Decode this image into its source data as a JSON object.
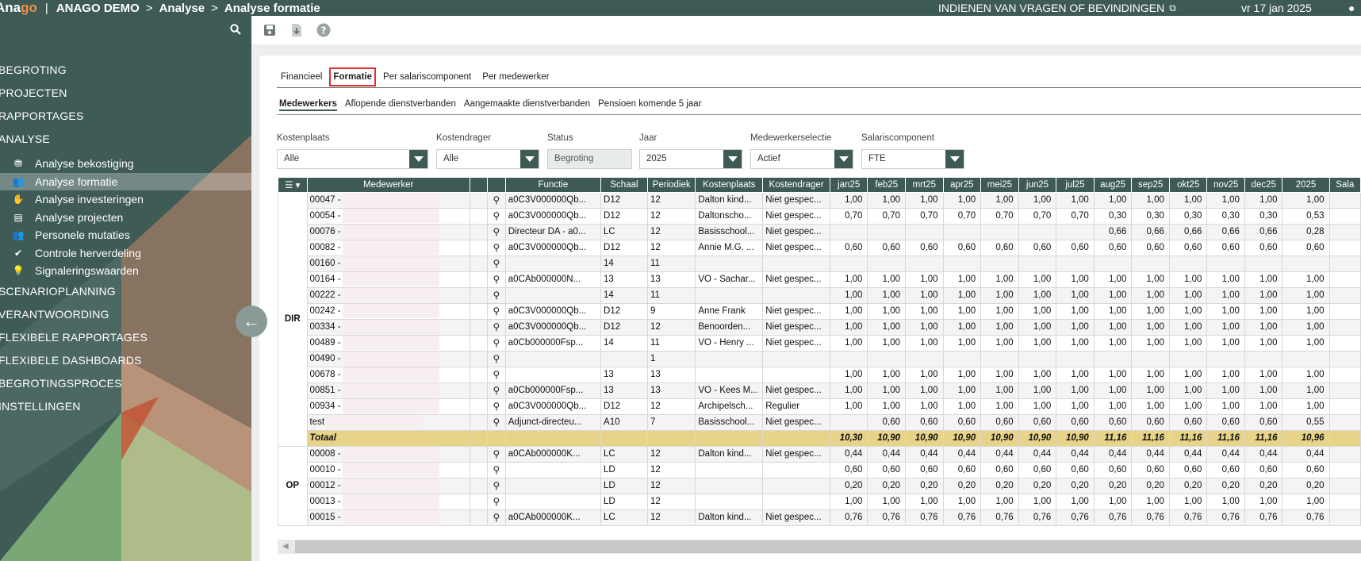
{
  "header": {
    "logo_a": "Ana",
    "logo_b": "go",
    "title": "ANAGO DEMO",
    "crumb1": "Analyse",
    "crumb2": "Analyse formatie",
    "report_link": "INDIENEN VAN VRAGEN OF BEVINDINGEN",
    "date": "vr 17 jan 2025"
  },
  "menu": {
    "top": [
      "BEGROTING",
      "PROJECTEN",
      "RAPPORTAGES",
      "ANALYSE"
    ],
    "sub": [
      {
        "label": "Analyse bekostiging",
        "icon": "coins-icon",
        "glyph": "⛃"
      },
      {
        "label": "Analyse formatie",
        "icon": "users-icon",
        "glyph": "👥"
      },
      {
        "label": "Analyse investeringen",
        "icon": "hand-coin-icon",
        "glyph": "✋"
      },
      {
        "label": "Analyse projecten",
        "icon": "clipboard-icon",
        "glyph": "▤"
      },
      {
        "label": "Personele mutaties",
        "icon": "users-icon",
        "glyph": "👥"
      },
      {
        "label": "Controle herverdeling",
        "icon": "check-icon",
        "glyph": "✔"
      },
      {
        "label": "Signaleringswaarden",
        "icon": "lightbulb-icon",
        "glyph": "💡"
      }
    ],
    "bottom": [
      "SCENARIOPLANNING",
      "VERANTWOORDING",
      "FLEXIBELE RAPPORTAGES",
      "FLEXIBELE DASHBOARDS",
      "BEGROTINGSPROCES",
      "INSTELLINGEN"
    ],
    "badge": "!"
  },
  "tabs": [
    "Financieel",
    "Formatie",
    "Per salariscomponent",
    "Per medewerker"
  ],
  "subtabs": [
    "Medewerkers",
    "Aflopende dienstverbanden",
    "Aangemaakte dienstverbanden",
    "Pensioen komende 5 jaar"
  ],
  "filters": [
    {
      "label": "Kostenplaats",
      "value": "Alle"
    },
    {
      "label": "Kostendrager",
      "value": "Alle"
    },
    {
      "label": "Status",
      "value": "Begroting"
    },
    {
      "label": "Jaar",
      "value": "2025"
    },
    {
      "label": "Medewerkerselectie",
      "value": "Actief"
    },
    {
      "label": "Salariscomponent",
      "value": "FTE"
    }
  ],
  "columns": [
    "Medewerker",
    "Functie",
    "Schaal",
    "Periodiek",
    "Kostenplaats",
    "Kostendrager",
    "jan25",
    "feb25",
    "mrt25",
    "apr25",
    "mei25",
    "jun25",
    "jul25",
    "aug25",
    "sep25",
    "okt25",
    "nov25",
    "dec25",
    "2025",
    "Sala"
  ],
  "groups": [
    {
      "name": "DIR",
      "rows": [
        [
          "00047 -",
          "a0C3V000000Qb...",
          "D12",
          "12",
          "Dalton kind...",
          "Niet gespec...",
          "1,00",
          "1,00",
          "1,00",
          "1,00",
          "1,00",
          "1,00",
          "1,00",
          "1,00",
          "1,00",
          "1,00",
          "1,00",
          "1,00",
          "1,00"
        ],
        [
          "00054 -",
          "a0C3V000000Qb...",
          "D12",
          "12",
          "Daltonscho...",
          "Niet gespec...",
          "0,70",
          "0,70",
          "0,70",
          "0,70",
          "0,70",
          "0,70",
          "0,70",
          "0,30",
          "0,30",
          "0,30",
          "0,30",
          "0,30",
          "0,53"
        ],
        [
          "00076 -",
          "Directeur DA - a0...",
          "LC",
          "12",
          "Basisschool...",
          "Niet gespec...",
          "",
          "",
          "",
          "",
          "",
          "",
          "",
          "0,66",
          "0,66",
          "0,66",
          "0,66",
          "0,66",
          "0,28"
        ],
        [
          "00082 -",
          "a0C3V000000Qb...",
          "D12",
          "12",
          "Annie M.G. ...",
          "Niet gespec...",
          "0,60",
          "0,60",
          "0,60",
          "0,60",
          "0,60",
          "0,60",
          "0,60",
          "0,60",
          "0,60",
          "0,60",
          "0,60",
          "0,60",
          "0,60"
        ],
        [
          "00160 -",
          "",
          "14",
          "11",
          "",
          "",
          "",
          "",
          "",
          "",
          "",
          "",
          "",
          "",
          "",
          "",
          "",
          "",
          ""
        ],
        [
          "00164 -",
          "a0CAb000000N...",
          "13",
          "13",
          "VO - Sachar...",
          "Niet gespec...",
          "1,00",
          "1,00",
          "1,00",
          "1,00",
          "1,00",
          "1,00",
          "1,00",
          "1,00",
          "1,00",
          "1,00",
          "1,00",
          "1,00",
          "1,00"
        ],
        [
          "00222 -",
          "",
          "14",
          "11",
          "",
          "",
          "1,00",
          "1,00",
          "1,00",
          "1,00",
          "1,00",
          "1,00",
          "1,00",
          "1,00",
          "1,00",
          "1,00",
          "1,00",
          "1,00",
          "1,00"
        ],
        [
          "00242 -",
          "a0C3V000000Qb...",
          "D12",
          "9",
          "Anne Frank",
          "Niet gespec...",
          "1,00",
          "1,00",
          "1,00",
          "1,00",
          "1,00",
          "1,00",
          "1,00",
          "1,00",
          "1,00",
          "1,00",
          "1,00",
          "1,00",
          "1,00"
        ],
        [
          "00334 -",
          "a0C3V000000Qb...",
          "D12",
          "12",
          "Benoorden...",
          "Niet gespec...",
          "1,00",
          "1,00",
          "1,00",
          "1,00",
          "1,00",
          "1,00",
          "1,00",
          "1,00",
          "1,00",
          "1,00",
          "1,00",
          "1,00",
          "1,00"
        ],
        [
          "00489 -",
          "a0Cb000000Fsp...",
          "14",
          "11",
          "VO - Henry ...",
          "Niet gespec...",
          "1,00",
          "1,00",
          "1,00",
          "1,00",
          "1,00",
          "1,00",
          "1,00",
          "1,00",
          "1,00",
          "1,00",
          "1,00",
          "1,00",
          "1,00"
        ],
        [
          "00490 -",
          "",
          "",
          "1",
          "",
          "",
          "",
          "",
          "",
          "",
          "",
          "",
          "",
          "",
          "",
          "",
          "",
          "",
          ""
        ],
        [
          "00678 -",
          "",
          "13",
          "13",
          "",
          "",
          "1,00",
          "1,00",
          "1,00",
          "1,00",
          "1,00",
          "1,00",
          "1,00",
          "1,00",
          "1,00",
          "1,00",
          "1,00",
          "1,00",
          "1,00"
        ],
        [
          "00851 -",
          "a0Cb000000Fsp...",
          "13",
          "13",
          "VO - Kees M...",
          "Niet gespec...",
          "1,00",
          "1,00",
          "1,00",
          "1,00",
          "1,00",
          "1,00",
          "1,00",
          "1,00",
          "1,00",
          "1,00",
          "1,00",
          "1,00",
          "1,00"
        ],
        [
          "00934 -",
          "a0C3V000000Qb...",
          "D12",
          "12",
          "Archipelsch...",
          "Regulier",
          "1,00",
          "1,00",
          "1,00",
          "1,00",
          "1,00",
          "1,00",
          "1,00",
          "1,00",
          "1,00",
          "1,00",
          "1,00",
          "1,00",
          "1,00"
        ],
        [
          "test",
          "Adjunct-directeu...",
          "A10",
          "7",
          "Basisschool...",
          "Niet gespec...",
          "",
          "0,60",
          "0,60",
          "0,60",
          "0,60",
          "0,60",
          "0,60",
          "0,60",
          "0,60",
          "0,60",
          "0,60",
          "0,60",
          "0,55"
        ]
      ],
      "total": [
        "Totaal",
        "10,30",
        "10,90",
        "10,90",
        "10,90",
        "10,90",
        "10,90",
        "10,90",
        "11,16",
        "11,16",
        "11,16",
        "11,16",
        "11,16",
        "10,96"
      ]
    },
    {
      "name": "OP",
      "rows": [
        [
          "00008 -",
          "a0CAb000000K...",
          "LC",
          "12",
          "Dalton kind...",
          "Niet gespec...",
          "0,44",
          "0,44",
          "0,44",
          "0,44",
          "0,44",
          "0,44",
          "0,44",
          "0,44",
          "0,44",
          "0,44",
          "0,44",
          "0,44",
          "0,44"
        ],
        [
          "00010 -",
          "",
          "LD",
          "12",
          "",
          "",
          "0,60",
          "0,60",
          "0,60",
          "0,60",
          "0,60",
          "0,60",
          "0,60",
          "0,60",
          "0,60",
          "0,60",
          "0,60",
          "0,60",
          "0,60"
        ],
        [
          "00012 -",
          "",
          "LD",
          "12",
          "",
          "",
          "0,20",
          "0,20",
          "0,20",
          "0,20",
          "0,20",
          "0,20",
          "0,20",
          "0,20",
          "0,20",
          "0,20",
          "0,20",
          "0,20",
          "0,20"
        ],
        [
          "00013 -",
          "",
          "LD",
          "12",
          "",
          "",
          "1,00",
          "1,00",
          "1,00",
          "1,00",
          "1,00",
          "1,00",
          "1,00",
          "1,00",
          "1,00",
          "1,00",
          "1,00",
          "1,00",
          "1,00"
        ],
        [
          "00015 -",
          "a0CAb000000K...",
          "LC",
          "12",
          "Dalton kind...",
          "Niet gespec...",
          "0,76",
          "0,76",
          "0,76",
          "0,76",
          "0,76",
          "0,76",
          "0,76",
          "0,76",
          "0,76",
          "0,76",
          "0,76",
          "0,76",
          "0,76"
        ]
      ]
    }
  ]
}
